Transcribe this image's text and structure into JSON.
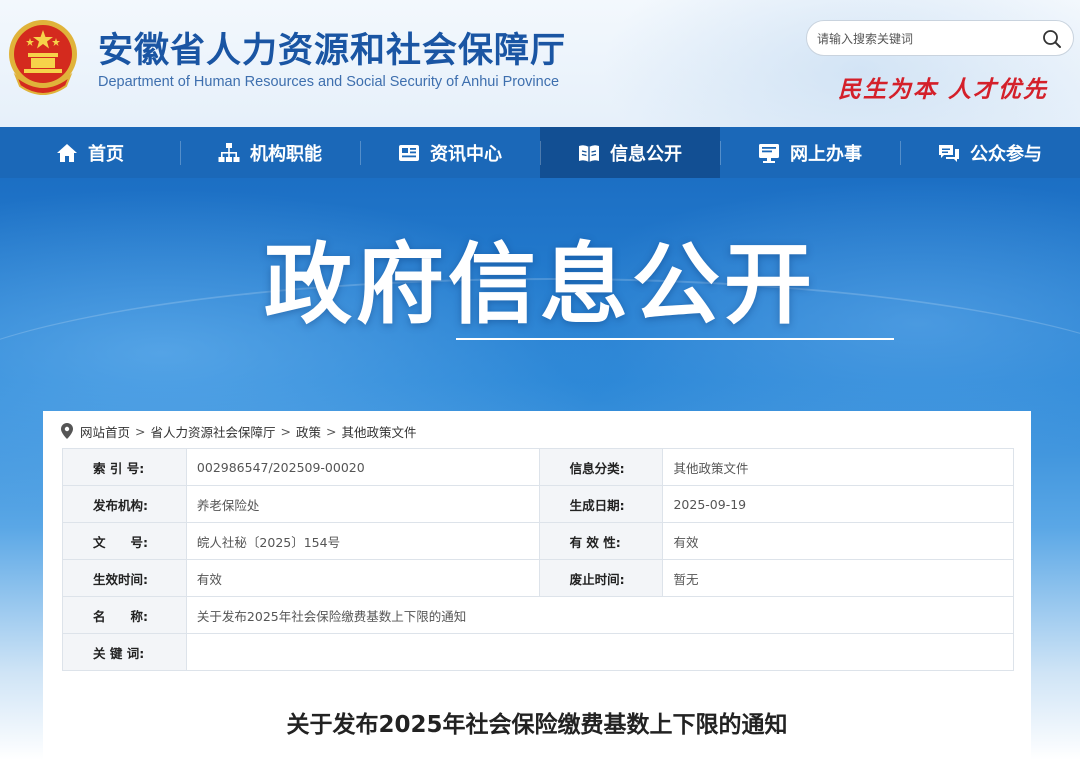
{
  "header": {
    "title": "安徽省人力资源和社会保障厅",
    "subtitle": "Department of Human Resources and Social Security of Anhui Province",
    "search_placeholder": "请输入搜索关键词",
    "slogan": "民生为本 人才优先",
    "emblem_icon": "national-emblem-icon",
    "search_icon": "search-icon"
  },
  "nav": {
    "items": [
      {
        "label": "首页",
        "icon": "home-icon",
        "active": false
      },
      {
        "label": "机构职能",
        "icon": "org-chart-icon",
        "active": false
      },
      {
        "label": "资讯中心",
        "icon": "news-icon",
        "active": false
      },
      {
        "label": "信息公开",
        "icon": "book-icon",
        "active": true
      },
      {
        "label": "网上办事",
        "icon": "monitor-icon",
        "active": false
      },
      {
        "label": "公众参与",
        "icon": "chat-icon",
        "active": false
      }
    ]
  },
  "banner": {
    "title": "政府信息公开"
  },
  "breadcrumb": {
    "items": [
      "网站首页",
      "省人力资源社会保障厅",
      "政策",
      "其他政策文件"
    ],
    "separator": ">"
  },
  "info_table": {
    "rows": [
      {
        "label1": "索 引 号:",
        "value1": "002986547/202509-00020",
        "label2": "信息分类:",
        "value2": "其他政策文件"
      },
      {
        "label1": "发布机构:",
        "value1": "养老保险处",
        "label2": "生成日期:",
        "value2": "2025-09-19"
      },
      {
        "label1": "文　　号:",
        "value1": "皖人社秘〔2025〕154号",
        "label2": "有 效 性:",
        "value2": "有效"
      },
      {
        "label1": "生效时间:",
        "value1": "有效",
        "label2": "废止时间:",
        "value2": "暂无"
      }
    ],
    "name_label": "名　　称:",
    "name_value": "关于发布2025年社会保险缴费基数上下限的通知",
    "keywords_label": "关 键 词:",
    "keywords_value": ""
  },
  "document": {
    "title": "关于发布2025年社会保险缴费基数上下限的通知"
  },
  "colors": {
    "brand_blue": "#1b68b8",
    "nav_active": "#124f93",
    "title_blue": "#1a55a3",
    "slogan_red": "#d4202a"
  }
}
